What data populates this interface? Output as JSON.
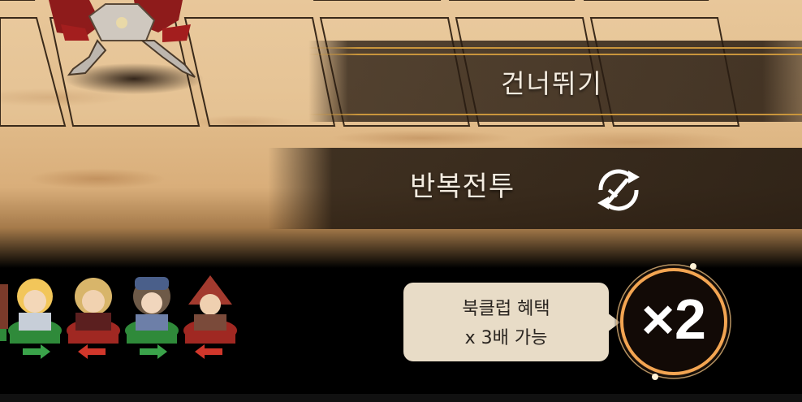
{
  "battle": {
    "skip_label": "건너뛰기",
    "repeat_label": "반복전투",
    "repeat_icon": "repeat-sword-icon",
    "speed_label": "×2",
    "tooltip": {
      "line1": "북클럽 혜택",
      "line2": "x 3배 가능"
    }
  },
  "party": {
    "heroes": [
      {
        "name": "hero-portrait-1",
        "arrow": "right",
        "arrow_color": "#3aa34a",
        "base_color": "#2f8a3a"
      },
      {
        "name": "hero-portrait-2",
        "arrow": "left",
        "arrow_color": "#d1372b",
        "base_color": "#a02822"
      },
      {
        "name": "hero-portrait-3",
        "arrow": "right",
        "arrow_color": "#3aa34a",
        "base_color": "#2f8a3a"
      },
      {
        "name": "hero-portrait-4",
        "arrow": "left",
        "arrow_color": "#d1372b",
        "base_color": "#a02822"
      }
    ]
  },
  "colors": {
    "accent_gold": "#c9953c",
    "band": "#2a1d12",
    "tooltip_bg": "#e8dcc7",
    "speed_ring": "#f3a552"
  }
}
